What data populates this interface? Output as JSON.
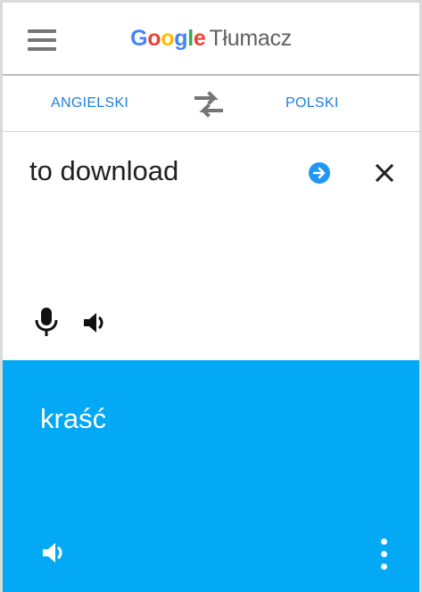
{
  "header": {
    "brand_letters": [
      "G",
      "o",
      "o",
      "g",
      "l",
      "e"
    ],
    "product": "Tłumacz",
    "menu_icon": "hamburger-menu-icon"
  },
  "languages": {
    "source": "ANGIELSKI",
    "target": "POLSKI",
    "swap_icon": "swap-arrows-icon"
  },
  "input": {
    "text": "to download",
    "go_icon": "arrow-right-circle-icon",
    "clear_icon": "close-icon",
    "mic_icon": "microphone-icon",
    "speak_icon": "speaker-icon"
  },
  "result": {
    "text": "kraść",
    "speak_icon": "speaker-icon",
    "more_icon": "more-vert-icon"
  },
  "colors": {
    "accent": "#1f7fe0",
    "result_background": "#03a9f4",
    "google_blue": "#4285f4",
    "google_red": "#ea4335",
    "google_yellow": "#fbbc05",
    "google_green": "#34a853"
  }
}
